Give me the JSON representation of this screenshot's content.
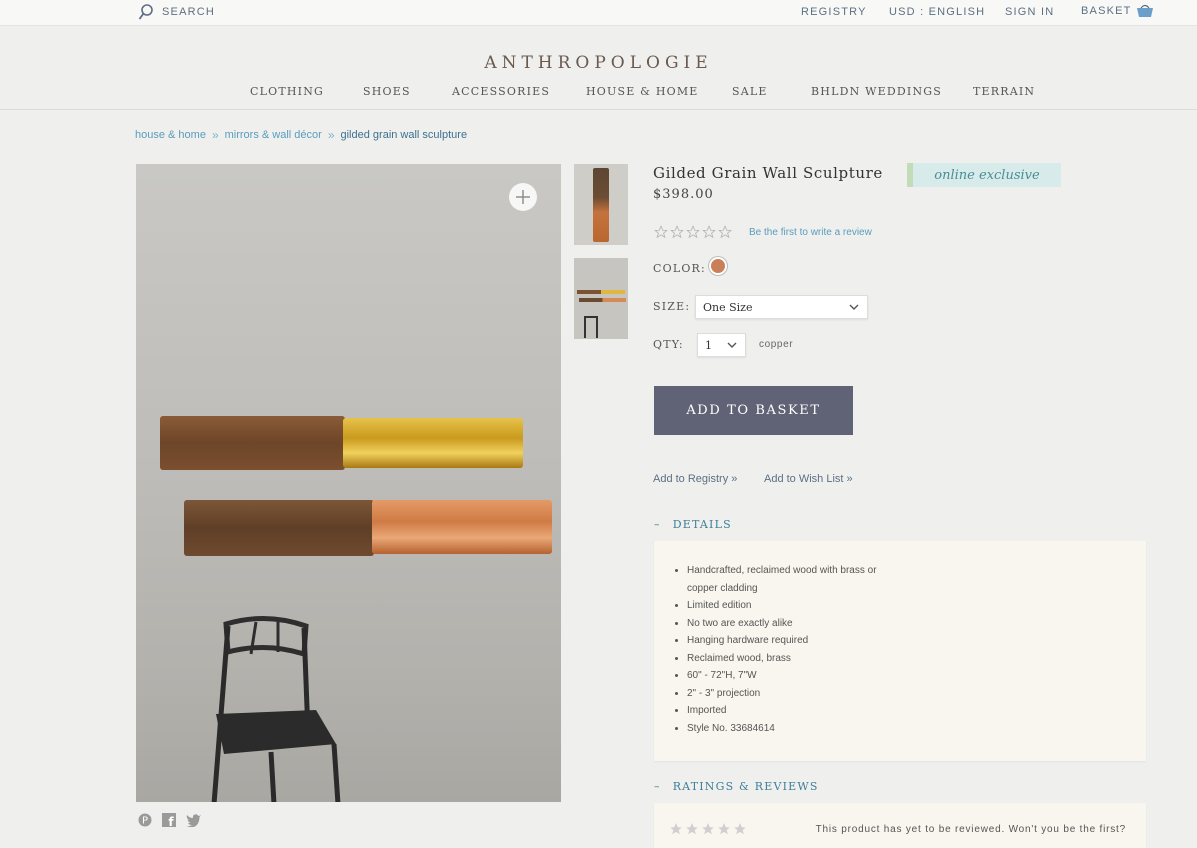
{
  "topbar": {
    "search_label": "SEARCH",
    "registry": "REGISTRY",
    "currency": "USD : ENGLISH",
    "sign_in": "SIGN IN",
    "basket": "BASKET"
  },
  "header": {
    "logo": "ANTHROPOLOGIE",
    "nav": [
      "CLOTHING",
      "SHOES",
      "ACCESSORIES",
      "HOUSE & HOME",
      "SALE",
      "BHLDN WEDDINGS",
      "TERRAIN"
    ]
  },
  "breadcrumb": [
    "house & home",
    "mirrors & wall décor",
    "gilded grain wall sculpture"
  ],
  "product": {
    "title": "Gilded Grain Wall Sculpture",
    "price": "$398.00",
    "badge": "online exclusive",
    "rating": 0,
    "review_prompt": "Be the first to write a review",
    "color_label": "COLOR:",
    "color_swatch": "#c97f57",
    "size_label": "SIZE:",
    "size_value": "One Size",
    "qty_label": "QTY:",
    "qty_value": "1",
    "color_name": "copper",
    "add_to_basket": "ADD TO BASKET",
    "add_to_registry": "Add to Registry »",
    "add_to_wishlist": "Add to Wish List »"
  },
  "details": {
    "heading": "DETAILS",
    "toggle": "–",
    "bullets": [
      "Handcrafted, reclaimed wood with brass or copper cladding",
      "Limited edition",
      "No two are exactly alike",
      "Hanging hardware required",
      "Reclaimed wood, brass",
      "60\" - 72\"H, 7\"W",
      "2\" - 3\" projection",
      "Imported",
      "Style No. 33684614"
    ]
  },
  "reviews": {
    "heading": "RATINGS & REVIEWS",
    "toggle": "–",
    "message": "This product has yet to be reviewed. Won't you be the first?"
  },
  "colors": {
    "link_blue": "#5a9cbc",
    "button": "#5f6375",
    "section_teal": "#3d7e98"
  }
}
